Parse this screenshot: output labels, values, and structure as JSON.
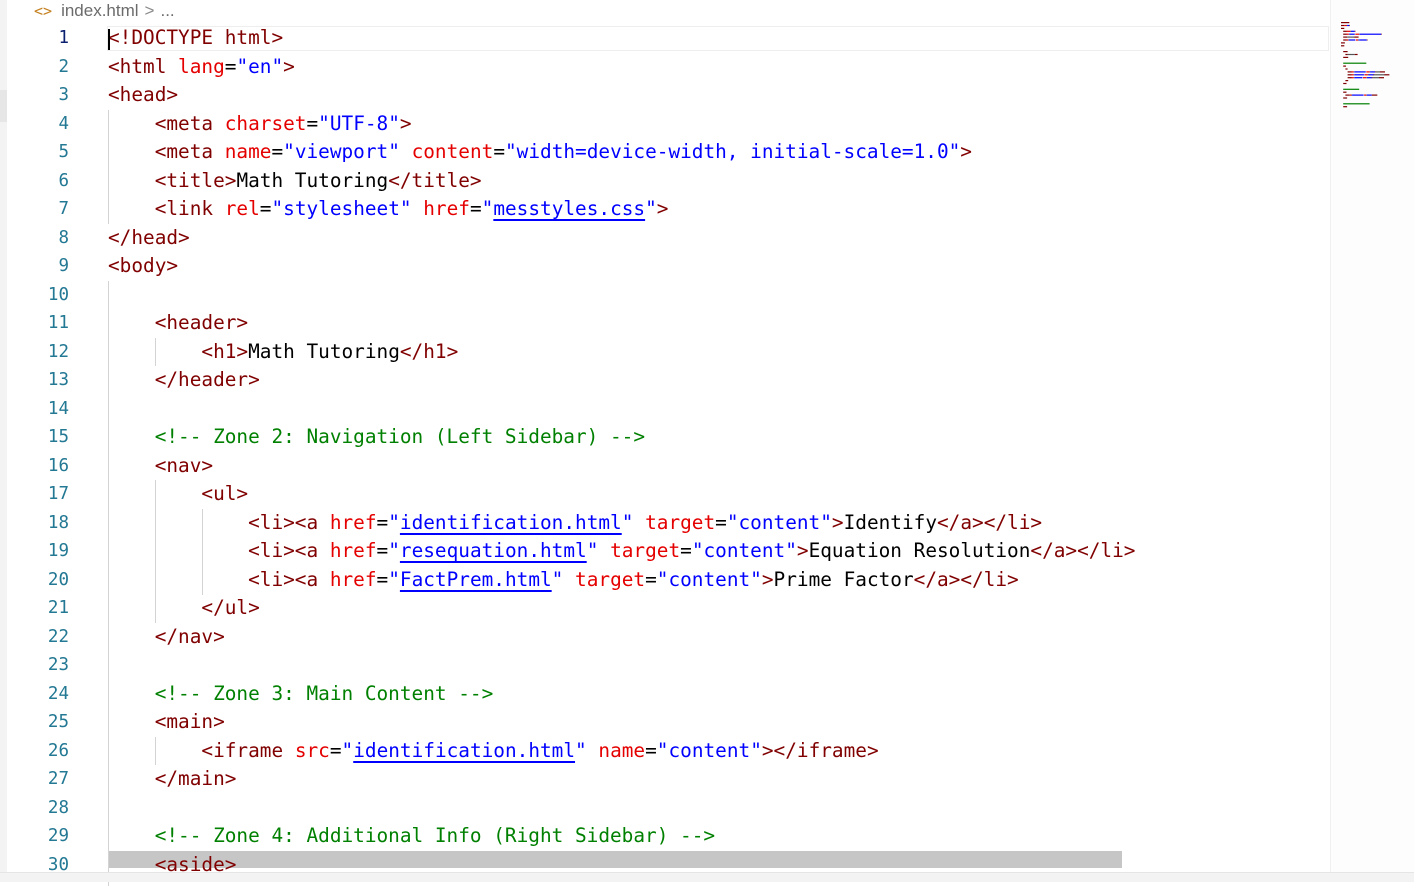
{
  "breadcrumb": {
    "icon": "code-file-icon",
    "file": "index.html",
    "separator": ">",
    "trailing": "..."
  },
  "editor": {
    "active_line": 1,
    "lines": [
      {
        "n": "1",
        "parts": [
          {
            "k": "t",
            "v": "<!DOCTYPE html>"
          }
        ]
      },
      {
        "n": "2",
        "parts": [
          {
            "k": "t",
            "v": "<html "
          },
          {
            "k": "a",
            "v": "lang"
          },
          {
            "k": "p",
            "v": "="
          },
          {
            "k": "s",
            "v": "\"en\""
          },
          {
            "k": "t",
            "v": ">"
          }
        ]
      },
      {
        "n": "3",
        "parts": [
          {
            "k": "t",
            "v": "<head>"
          }
        ]
      },
      {
        "n": "4",
        "parts": [
          {
            "k": "p",
            "v": "    "
          },
          {
            "k": "t",
            "v": "<meta "
          },
          {
            "k": "a",
            "v": "charset"
          },
          {
            "k": "p",
            "v": "="
          },
          {
            "k": "s",
            "v": "\"UTF-8\""
          },
          {
            "k": "t",
            "v": ">"
          }
        ]
      },
      {
        "n": "5",
        "parts": [
          {
            "k": "p",
            "v": "    "
          },
          {
            "k": "t",
            "v": "<meta "
          },
          {
            "k": "a",
            "v": "name"
          },
          {
            "k": "p",
            "v": "="
          },
          {
            "k": "s",
            "v": "\"viewport\""
          },
          {
            "k": "p",
            "v": " "
          },
          {
            "k": "a",
            "v": "content"
          },
          {
            "k": "p",
            "v": "="
          },
          {
            "k": "s",
            "v": "\"width=device-width, initial-scale=1.0\""
          },
          {
            "k": "t",
            "v": ">"
          }
        ]
      },
      {
        "n": "6",
        "parts": [
          {
            "k": "p",
            "v": "    "
          },
          {
            "k": "t",
            "v": "<title>"
          },
          {
            "k": "p",
            "v": "Math Tutoring"
          },
          {
            "k": "t",
            "v": "</title>"
          }
        ]
      },
      {
        "n": "7",
        "parts": [
          {
            "k": "p",
            "v": "    "
          },
          {
            "k": "t",
            "v": "<link "
          },
          {
            "k": "a",
            "v": "rel"
          },
          {
            "k": "p",
            "v": "="
          },
          {
            "k": "s",
            "v": "\"stylesheet\""
          },
          {
            "k": "p",
            "v": " "
          },
          {
            "k": "a",
            "v": "href"
          },
          {
            "k": "p",
            "v": "="
          },
          {
            "k": "s",
            "v": "\""
          },
          {
            "k": "link",
            "v": "messtyles.css"
          },
          {
            "k": "s",
            "v": "\""
          },
          {
            "k": "t",
            "v": ">"
          }
        ]
      },
      {
        "n": "8",
        "parts": [
          {
            "k": "t",
            "v": "</head>"
          }
        ]
      },
      {
        "n": "9",
        "parts": [
          {
            "k": "t",
            "v": "<body>"
          }
        ]
      },
      {
        "n": "10",
        "parts": []
      },
      {
        "n": "11",
        "parts": [
          {
            "k": "p",
            "v": "    "
          },
          {
            "k": "t",
            "v": "<header>"
          }
        ]
      },
      {
        "n": "12",
        "parts": [
          {
            "k": "p",
            "v": "        "
          },
          {
            "k": "t",
            "v": "<h1>"
          },
          {
            "k": "p",
            "v": "Math Tutoring"
          },
          {
            "k": "t",
            "v": "</h1>"
          }
        ]
      },
      {
        "n": "13",
        "parts": [
          {
            "k": "p",
            "v": "    "
          },
          {
            "k": "t",
            "v": "</header>"
          }
        ]
      },
      {
        "n": "14",
        "parts": []
      },
      {
        "n": "15",
        "parts": [
          {
            "k": "p",
            "v": "    "
          },
          {
            "k": "c",
            "v": "<!-- Zone 2: Navigation (Left Sidebar) -->"
          }
        ]
      },
      {
        "n": "16",
        "parts": [
          {
            "k": "p",
            "v": "    "
          },
          {
            "k": "t",
            "v": "<nav>"
          }
        ]
      },
      {
        "n": "17",
        "parts": [
          {
            "k": "p",
            "v": "        "
          },
          {
            "k": "t",
            "v": "<ul>"
          }
        ]
      },
      {
        "n": "18",
        "parts": [
          {
            "k": "p",
            "v": "            "
          },
          {
            "k": "t",
            "v": "<li><a "
          },
          {
            "k": "a",
            "v": "href"
          },
          {
            "k": "p",
            "v": "="
          },
          {
            "k": "s",
            "v": "\""
          },
          {
            "k": "link",
            "v": "identification.html"
          },
          {
            "k": "s",
            "v": "\""
          },
          {
            "k": "p",
            "v": " "
          },
          {
            "k": "a",
            "v": "target"
          },
          {
            "k": "p",
            "v": "="
          },
          {
            "k": "s",
            "v": "\"content\""
          },
          {
            "k": "t",
            "v": ">"
          },
          {
            "k": "p",
            "v": "Identify"
          },
          {
            "k": "t",
            "v": "</a></li>"
          }
        ]
      },
      {
        "n": "19",
        "parts": [
          {
            "k": "p",
            "v": "            "
          },
          {
            "k": "t",
            "v": "<li><a "
          },
          {
            "k": "a",
            "v": "href"
          },
          {
            "k": "p",
            "v": "="
          },
          {
            "k": "s",
            "v": "\""
          },
          {
            "k": "link",
            "v": "resequation.html"
          },
          {
            "k": "s",
            "v": "\""
          },
          {
            "k": "p",
            "v": " "
          },
          {
            "k": "a",
            "v": "target"
          },
          {
            "k": "p",
            "v": "="
          },
          {
            "k": "s",
            "v": "\"content\""
          },
          {
            "k": "t",
            "v": ">"
          },
          {
            "k": "p",
            "v": "Equation Resolution"
          },
          {
            "k": "t",
            "v": "</a></li>"
          }
        ]
      },
      {
        "n": "20",
        "parts": [
          {
            "k": "p",
            "v": "            "
          },
          {
            "k": "t",
            "v": "<li><a "
          },
          {
            "k": "a",
            "v": "href"
          },
          {
            "k": "p",
            "v": "="
          },
          {
            "k": "s",
            "v": "\""
          },
          {
            "k": "link",
            "v": "FactPrem.html"
          },
          {
            "k": "s",
            "v": "\""
          },
          {
            "k": "p",
            "v": " "
          },
          {
            "k": "a",
            "v": "target"
          },
          {
            "k": "p",
            "v": "="
          },
          {
            "k": "s",
            "v": "\"content\""
          },
          {
            "k": "t",
            "v": ">"
          },
          {
            "k": "p",
            "v": "Prime Factor"
          },
          {
            "k": "t",
            "v": "</a></li>"
          }
        ]
      },
      {
        "n": "21",
        "parts": [
          {
            "k": "p",
            "v": "        "
          },
          {
            "k": "t",
            "v": "</ul>"
          }
        ]
      },
      {
        "n": "22",
        "parts": [
          {
            "k": "p",
            "v": "    "
          },
          {
            "k": "t",
            "v": "</nav>"
          }
        ]
      },
      {
        "n": "23",
        "parts": []
      },
      {
        "n": "24",
        "parts": [
          {
            "k": "p",
            "v": "    "
          },
          {
            "k": "c",
            "v": "<!-- Zone 3: Main Content -->"
          }
        ]
      },
      {
        "n": "25",
        "parts": [
          {
            "k": "p",
            "v": "    "
          },
          {
            "k": "t",
            "v": "<main>"
          }
        ]
      },
      {
        "n": "26",
        "parts": [
          {
            "k": "p",
            "v": "        "
          },
          {
            "k": "t",
            "v": "<iframe "
          },
          {
            "k": "a",
            "v": "src"
          },
          {
            "k": "p",
            "v": "="
          },
          {
            "k": "s",
            "v": "\""
          },
          {
            "k": "link",
            "v": "identification.html"
          },
          {
            "k": "s",
            "v": "\""
          },
          {
            "k": "p",
            "v": " "
          },
          {
            "k": "a",
            "v": "name"
          },
          {
            "k": "p",
            "v": "="
          },
          {
            "k": "s",
            "v": "\"content\""
          },
          {
            "k": "t",
            "v": "></iframe>"
          }
        ]
      },
      {
        "n": "27",
        "parts": [
          {
            "k": "p",
            "v": "    "
          },
          {
            "k": "t",
            "v": "</main>"
          }
        ]
      },
      {
        "n": "28",
        "parts": []
      },
      {
        "n": "29",
        "parts": [
          {
            "k": "p",
            "v": "    "
          },
          {
            "k": "c",
            "v": "<!-- Zone 4: Additional Info (Right Sidebar) -->"
          }
        ]
      },
      {
        "n": "30",
        "parts": [
          {
            "k": "p",
            "v": "    "
          },
          {
            "k": "t",
            "v": "<aside>"
          }
        ]
      }
    ]
  },
  "colors": {
    "tag": "#800000",
    "attribute": "#e50000",
    "string": "#0000ff",
    "comment": "#008000",
    "line_number": "#237893"
  }
}
